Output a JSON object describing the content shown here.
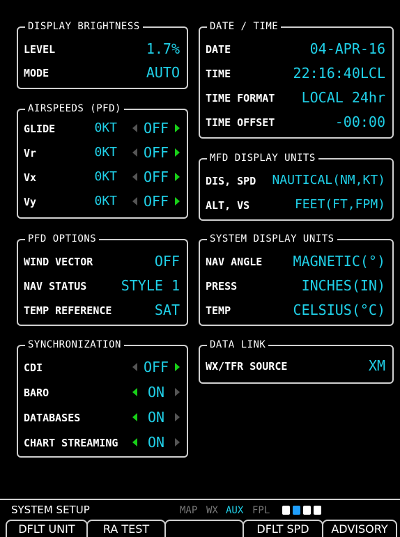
{
  "display_brightness": {
    "title": "DISPLAY BRIGHTNESS",
    "level_label": "LEVEL",
    "level_value": "1.7%",
    "mode_label": "MODE",
    "mode_value": "AUTO"
  },
  "airspeeds": {
    "title": "AIRSPEEDS (PFD)",
    "rows": [
      {
        "label": "GLIDE",
        "speed": "0KT",
        "toggle": "OFF"
      },
      {
        "label": "Vr",
        "speed": "0KT",
        "toggle": "OFF"
      },
      {
        "label": "Vx",
        "speed": "0KT",
        "toggle": "OFF"
      },
      {
        "label": "Vy",
        "speed": "0KT",
        "toggle": "OFF"
      }
    ]
  },
  "pfd_options": {
    "title": "PFD OPTIONS",
    "rows": [
      {
        "label": "WIND VECTOR",
        "value": "OFF"
      },
      {
        "label": "NAV STATUS",
        "value": "STYLE 1"
      },
      {
        "label": "TEMP REFERENCE",
        "value": "SAT"
      }
    ]
  },
  "synchronization": {
    "title": "SYNCHRONIZATION",
    "rows": [
      {
        "label": "CDI",
        "value": "OFF"
      },
      {
        "label": "BARO",
        "value": "ON"
      },
      {
        "label": "DATABASES",
        "value": "ON"
      },
      {
        "label": "CHART STREAMING",
        "value": "ON"
      }
    ]
  },
  "date_time": {
    "title": "DATE / TIME",
    "rows": [
      {
        "label": "DATE",
        "value": "04-APR-16"
      },
      {
        "label": "TIME",
        "value": "22:16:40LCL"
      },
      {
        "label": "TIME FORMAT",
        "value": "LOCAL 24hr"
      },
      {
        "label": "TIME OFFSET",
        "value": "-00:00"
      }
    ]
  },
  "mfd_units": {
    "title": "MFD DISPLAY UNITS",
    "rows": [
      {
        "label": "DIS, SPD",
        "value": "NAUTICAL(NM,KT)"
      },
      {
        "label": "ALT, VS",
        "value": "FEET(FT,FPM)"
      }
    ]
  },
  "system_units": {
    "title": "SYSTEM DISPLAY UNITS",
    "rows": [
      {
        "label": "NAV ANGLE",
        "value": "MAGNETIC(°)"
      },
      {
        "label": "PRESS",
        "value": "INCHES(IN)"
      },
      {
        "label": "TEMP",
        "value": "CELSIUS(°C)"
      }
    ]
  },
  "data_link": {
    "title": "DATA LINK",
    "rows": [
      {
        "label": "WX/TFR SOURCE",
        "value": "XM"
      }
    ]
  },
  "status": {
    "page_name": "SYSTEM SETUP",
    "groups": [
      "MAP",
      "WX",
      "AUX",
      "FPL"
    ],
    "active_group": "AUX",
    "active_color": "#20d0e8",
    "inactive_color": "#777777"
  },
  "softkeys": [
    "DFLT UNIT",
    "RA TEST",
    "",
    "DFLT SPD",
    "ADVISORY"
  ],
  "colors": {
    "value": "#20d0e8",
    "arrow_active": "#18d018",
    "border": "#cfcfcf"
  }
}
